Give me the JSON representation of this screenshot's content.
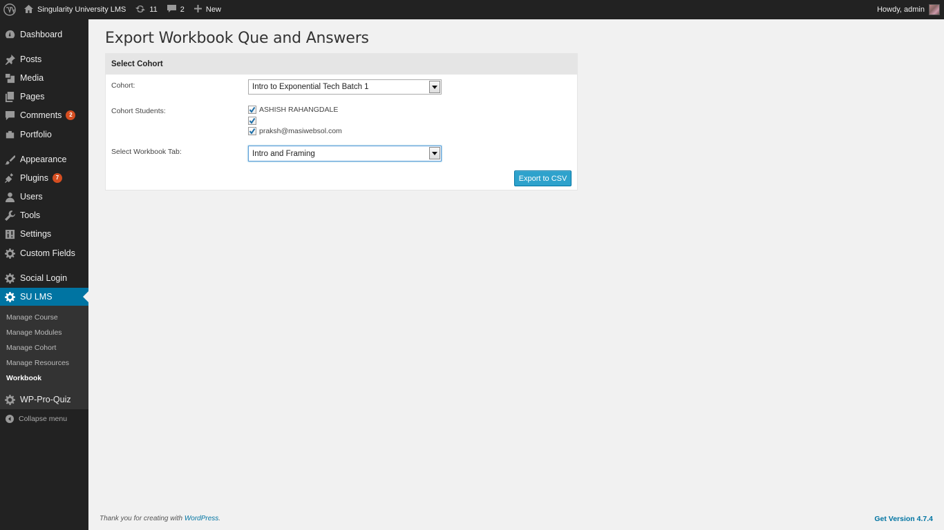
{
  "admin_bar": {
    "site_name": "Singularity University LMS",
    "updates_count": "11",
    "comments_count": "2",
    "new_label": "New",
    "greeting": "Howdy, admin"
  },
  "sidebar": {
    "items": [
      {
        "label": "Dashboard",
        "icon": "dashboard-icon"
      },
      {
        "label": "Posts",
        "icon": "pin-icon"
      },
      {
        "label": "Media",
        "icon": "media-icon"
      },
      {
        "label": "Pages",
        "icon": "pages-icon"
      },
      {
        "label": "Comments",
        "icon": "comment-icon",
        "badge": "2"
      },
      {
        "label": "Portfolio",
        "icon": "portfolio-icon"
      },
      {
        "label": "Appearance",
        "icon": "brush-icon"
      },
      {
        "label": "Plugins",
        "icon": "plug-icon",
        "badge": "7"
      },
      {
        "label": "Users",
        "icon": "user-icon"
      },
      {
        "label": "Tools",
        "icon": "wrench-icon"
      },
      {
        "label": "Settings",
        "icon": "settings-icon"
      },
      {
        "label": "Custom Fields",
        "icon": "gear-icon"
      },
      {
        "label": "Social Login",
        "icon": "gear-icon"
      },
      {
        "label": "SU LMS",
        "icon": "gear-icon"
      },
      {
        "label": "WP-Pro-Quiz",
        "icon": "gear-icon"
      }
    ],
    "submenu": [
      {
        "label": "Manage Course"
      },
      {
        "label": "Manage Modules"
      },
      {
        "label": "Manage Cohort"
      },
      {
        "label": "Manage Resources"
      },
      {
        "label": "Workbook"
      }
    ],
    "collapse_label": "Collapse menu"
  },
  "page": {
    "title": "Export Workbook Que and Answers",
    "box_title": "Select Cohort",
    "cohort_label": "Cohort:",
    "cohort_value": "Intro to Exponential Tech Batch 1",
    "students_label": "Cohort Students:",
    "students": [
      {
        "name": "ASHISH RAHANGDALE",
        "checked": true
      },
      {
        "name": "",
        "checked": true
      },
      {
        "name": "praksh@masiwebsol.com",
        "checked": true
      }
    ],
    "tab_label": "Select Workbook Tab:",
    "tab_value": "Intro and Framing",
    "export_button": "Export to CSV"
  },
  "footer": {
    "thanks_prefix": "Thank you for creating with ",
    "thanks_link": "WordPress",
    "thanks_suffix": ".",
    "version_link": "Get Version 4.7.4"
  },
  "colors": {
    "accent": "#0074a2",
    "button": "#2ea2cc",
    "badge": "#d54e21",
    "sidebar_bg": "#222222"
  }
}
